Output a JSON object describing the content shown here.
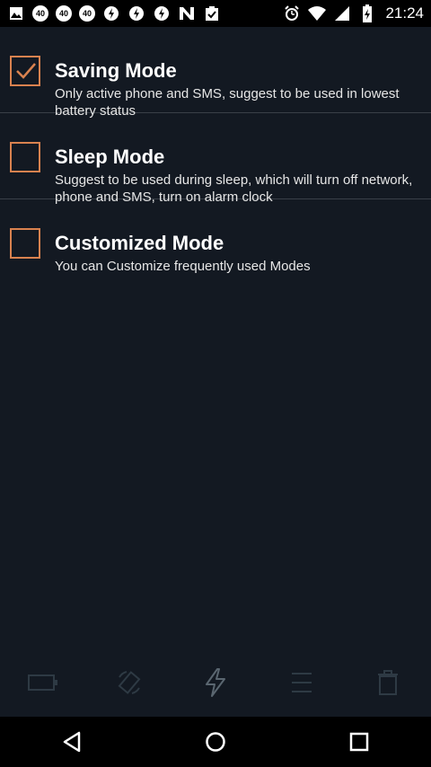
{
  "status_bar": {
    "badges": [
      "40",
      "40",
      "40"
    ],
    "clock": "21:24"
  },
  "modes": [
    {
      "title": "Saving Mode",
      "description": "Only active phone and SMS, suggest to be used in lowest battery status",
      "checked": true
    },
    {
      "title": "Sleep Mode",
      "description": "Suggest to be used during sleep, which will turn off network, phone and SMS, turn on alarm clock",
      "checked": false
    },
    {
      "title": "Customized Mode",
      "description": "You can Customize frequently used Modes",
      "checked": false
    }
  ],
  "colors": {
    "background": "#131922",
    "checkbox_accent": "#d9824f",
    "divider": "#3a4048",
    "toolbar_icon_dim": "#2e3a44",
    "toolbar_icon_active": "#5a6670"
  },
  "toolbar_icons": [
    "battery-icon",
    "rotate-icon",
    "lightning-icon",
    "menu-icon",
    "trash-icon"
  ],
  "nav_icons": [
    "back-icon",
    "home-icon",
    "recents-icon"
  ]
}
